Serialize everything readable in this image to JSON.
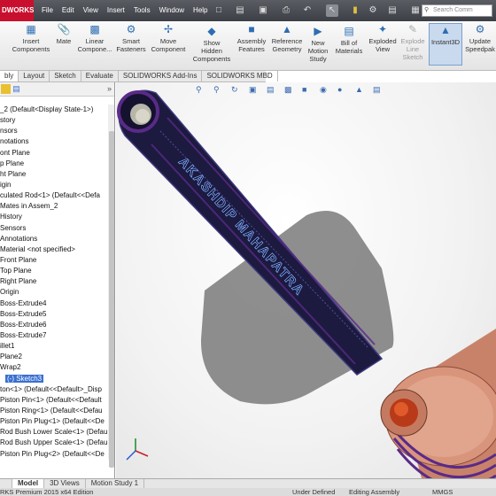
{
  "window": {
    "logo": "DWORKS",
    "menus": [
      "File",
      "Edit",
      "View",
      "Insert",
      "Tools",
      "Window",
      "Help"
    ],
    "search_placeholder": "Search Comm"
  },
  "ribbon": {
    "buttons": [
      {
        "label": "Insert\nComponents",
        "icon": "insert-components-icon"
      },
      {
        "label": "Mate",
        "icon": "mate-icon"
      },
      {
        "label": "Linear\nCompone...",
        "icon": "linear-pattern-icon"
      },
      {
        "label": "Smart\nFasteners",
        "icon": "smart-fasteners-icon"
      },
      {
        "label": "Move\nComponent",
        "icon": "move-component-icon"
      },
      {
        "label": "Show\nHidden\nComponents",
        "icon": "show-hidden-icon"
      },
      {
        "label": "Assembly\nFeatures",
        "icon": "assembly-features-icon"
      },
      {
        "label": "Reference\nGeometry",
        "icon": "reference-geometry-icon"
      },
      {
        "label": "New\nMotion\nStudy",
        "icon": "motion-study-icon"
      },
      {
        "label": "Bill of\nMaterials",
        "icon": "bom-icon"
      },
      {
        "label": "Exploded\nView",
        "icon": "exploded-view-icon"
      },
      {
        "label": "Explode\nLine\nSketch",
        "icon": "explode-line-icon"
      },
      {
        "label": "Instant3D",
        "icon": "instant3d-icon"
      },
      {
        "label": "Update\nSpeedpak",
        "icon": "speedpak-icon"
      }
    ]
  },
  "tabs": [
    "bly",
    "Layout",
    "Sketch",
    "Evaluate",
    "SOLIDWORKS Add-Ins",
    "SOLIDWORKS MBD"
  ],
  "tree": [
    "_2  (Default<Display State-1>)",
    "story",
    "nsors",
    "notations",
    "ont Plane",
    "p Plane",
    "ht Plane",
    "igin",
    "culated Rod<1> (Default<<Defa",
    "Mates in Assem_2",
    "History",
    "Sensors",
    "Annotations",
    "Material <not specified>",
    "Front Plane",
    "Top Plane",
    "Right Plane",
    "Origin",
    "Boss-Extrude4",
    "Boss-Extrude5",
    "Boss-Extrude6",
    "Boss-Extrude7",
    "illet1",
    "Plane2",
    "Wrap2",
    "(-) Sketch3",
    "ton<1> (Default<<Default>_Disp",
    "Piston Pin<1> (Default<<Default",
    "Piston Ring<1> (Default<<Defau",
    "Piston Pin Plug<1> (Default<<De",
    "Rod Bush Lower Scale<1> (Defau",
    "Rod Bush Upper Scale<1> (Defau",
    "Piston Pin Plug<2> (Default<<De"
  ],
  "selected_tree_item": "(-) Sketch3",
  "model": {
    "engraved_text": "AKASHDIP MAHAPATRA"
  },
  "bottom_tabs": [
    "Model",
    "3D Views",
    "Motion Study 1"
  ],
  "status": {
    "edition": "RKS Premium 2015 x64 Edition",
    "state": "Under Defined",
    "mode": "Editing Assembly",
    "units": "MMGS"
  }
}
